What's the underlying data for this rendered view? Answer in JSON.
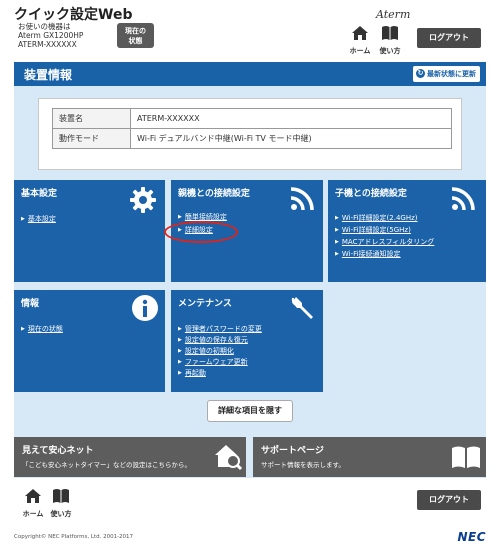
{
  "header": {
    "app_title": "クイック設定Web",
    "device_label": "お使いの機器は",
    "model": "Aterm GX1200HP",
    "device_name": "ATERM-XXXXXX",
    "status_button_line1": "現在の",
    "status_button_line2": "状態",
    "brand": "Aterm",
    "home_label": "ホーム",
    "help_label": "使い方",
    "logout_label": "ログアウト"
  },
  "panel": {
    "title": "装置情報",
    "refresh_label": "最新状態に更新",
    "info_rows": [
      {
        "key": "装置名",
        "value": "ATERM-XXXXXX"
      },
      {
        "key": "動作モード",
        "value": "Wi-Fi デュアルバンド中継(Wi-Fi TV モード中継)"
      }
    ]
  },
  "tiles": {
    "basic": {
      "title": "基本設定",
      "links": [
        "基本設定"
      ],
      "icon": "gear-icon"
    },
    "parent": {
      "title": "親機との接続設定",
      "links": [
        "簡単接続設定",
        "詳細設定"
      ],
      "icon": "wifi-icon"
    },
    "child": {
      "title": "子機との接続設定",
      "links": [
        "Wi-Fi詳細設定(2.4GHz)",
        "Wi-Fi詳細設定(5GHz)",
        "MACアドレスフィルタリング",
        "Wi-Fi接続通知設定"
      ],
      "icon": "wifi-icon"
    },
    "info": {
      "title": "情報",
      "links": [
        "現在の状態"
      ],
      "icon": "info-icon"
    },
    "maint": {
      "title": "メンテナンス",
      "links": [
        "管理者パスワードの変更",
        "設定値の保存＆復元",
        "設定値の初期化",
        "ファームウェア更新",
        "再起動"
      ],
      "icon": "wrench-icon"
    }
  },
  "detail_button": "詳細な項目を隠す",
  "bottom": {
    "safe_net_title": "見えて安心ネット",
    "safe_net_sub": "「こども安心ネットタイマー」などの設定はこちらから。",
    "support_title": "サポートページ",
    "support_sub": "サポート情報を表示します。"
  },
  "footer": {
    "home_label": "ホーム",
    "help_label": "使い方",
    "logout_label": "ログアウト",
    "copyright": "Copyright© NEC Platforms, Ltd. 2001-2017",
    "nec": "NEC"
  },
  "colors": {
    "tile_blue": "#1b62a8",
    "panel_bg": "#d7e9f6",
    "grey": "#5d5d5d",
    "highlight": "#e2231a"
  }
}
